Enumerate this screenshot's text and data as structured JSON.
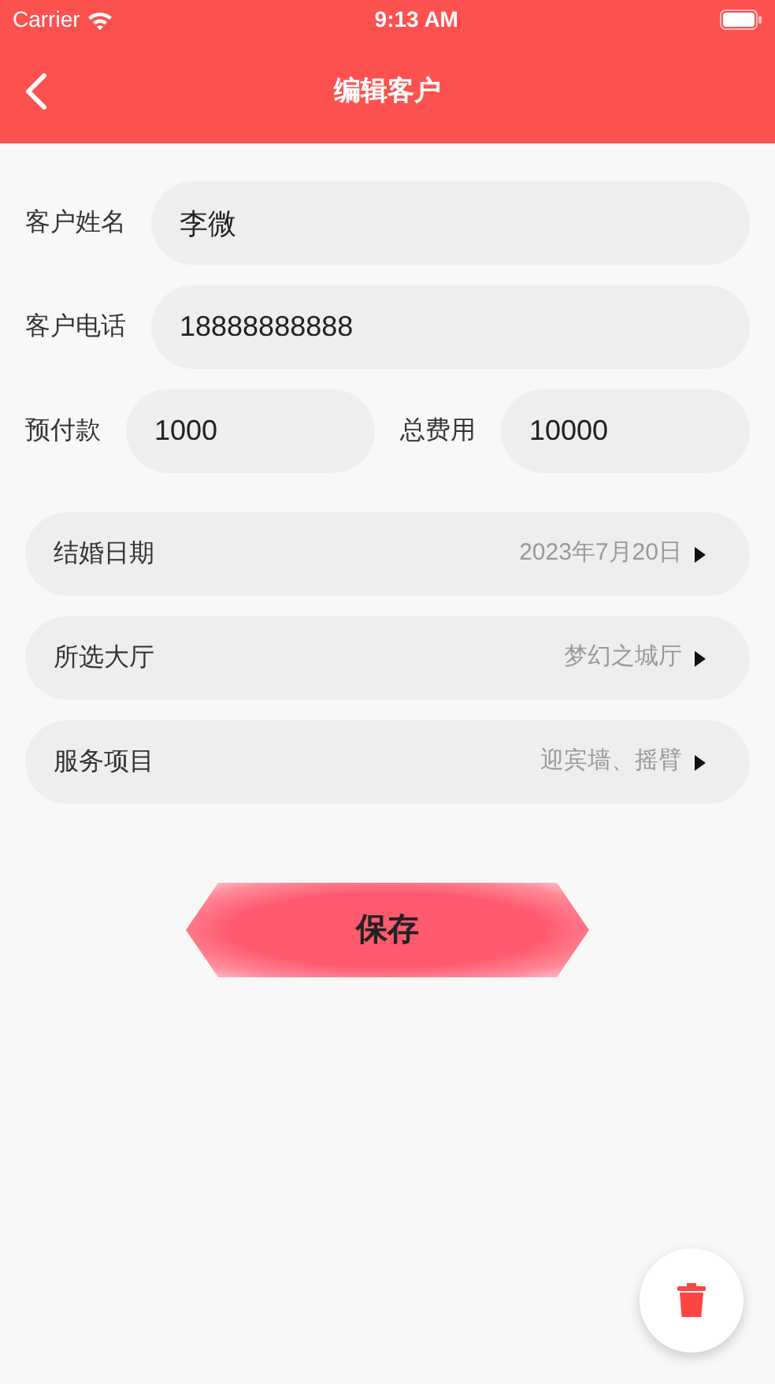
{
  "status_bar": {
    "carrier": "Carrier",
    "time": "9:13 AM"
  },
  "nav": {
    "title": "编辑客户"
  },
  "fields": [
    {
      "label": "客户姓名",
      "value": "李微"
    },
    {
      "label": "客户电话",
      "value": "18888888888"
    }
  ],
  "payment": [
    {
      "label": "预付款",
      "value": "1000"
    },
    {
      "label": "总费用",
      "value": "10000"
    }
  ],
  "pickers": [
    {
      "label": "结婚日期",
      "value": "2023年7月20日"
    },
    {
      "label": "所选大厅",
      "value": "梦幻之城厅"
    },
    {
      "label": "服务项目",
      "value": "迎宾墙、摇臂"
    }
  ],
  "save_button": {
    "label": "保存"
  }
}
